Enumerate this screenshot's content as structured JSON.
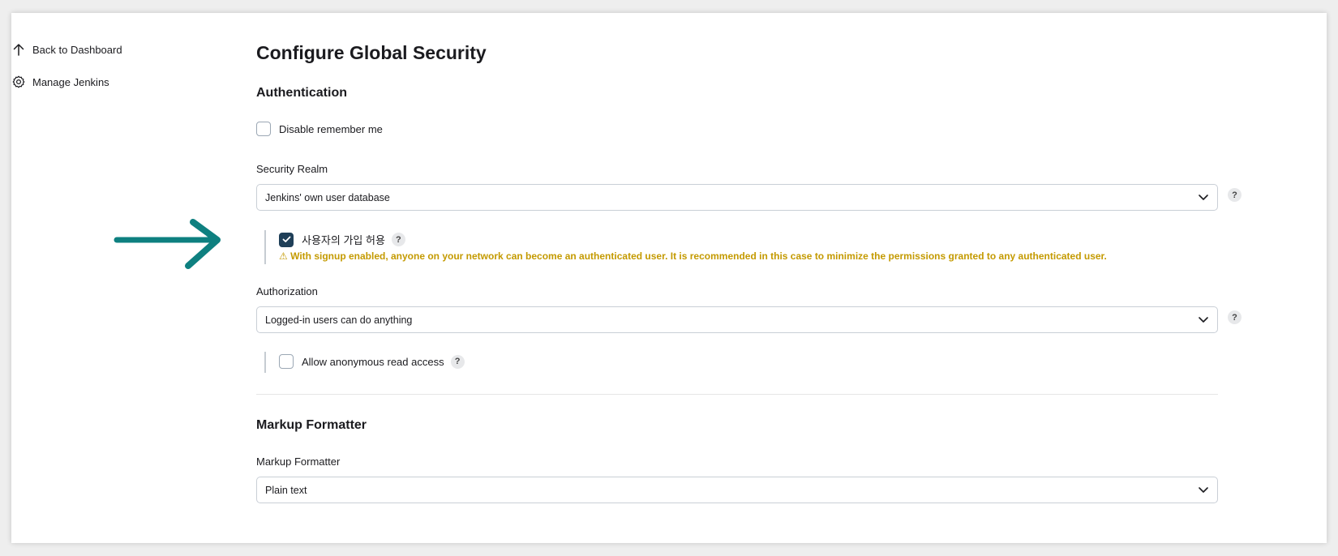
{
  "sidebar": {
    "back_label": "Back to Dashboard",
    "manage_label": "Manage Jenkins"
  },
  "page": {
    "title": "Configure Global Security"
  },
  "authentication": {
    "section_title": "Authentication",
    "disable_remember_me": {
      "label": "Disable remember me",
      "checked": false
    },
    "security_realm": {
      "label": "Security Realm",
      "selected": "Jenkins' own user database",
      "help": "?"
    },
    "allow_signup": {
      "label": "사용자의 가입 허용",
      "checked": true,
      "help": "?",
      "warning_icon": "⚠",
      "warning": "With signup enabled, anyone on your network can become an authenticated user. It is recommended in this case to minimize the permissions granted to any authenticated user."
    },
    "authorization": {
      "label": "Authorization",
      "selected": "Logged-in users can do anything",
      "help": "?"
    },
    "anonymous_read": {
      "label": "Allow anonymous read access",
      "checked": false,
      "help": "?"
    }
  },
  "markup": {
    "section_title": "Markup Formatter",
    "field_label": "Markup Formatter",
    "selected": "Plain text"
  },
  "colors": {
    "accent": "#1f3f58",
    "warning": "#c49a00",
    "annotation_arrow": "#0e8080"
  },
  "icons": {
    "back": "arrow-up-icon",
    "manage": "gear-icon",
    "select": "chevron-down-icon",
    "annotation": "arrow-right-annotation"
  }
}
